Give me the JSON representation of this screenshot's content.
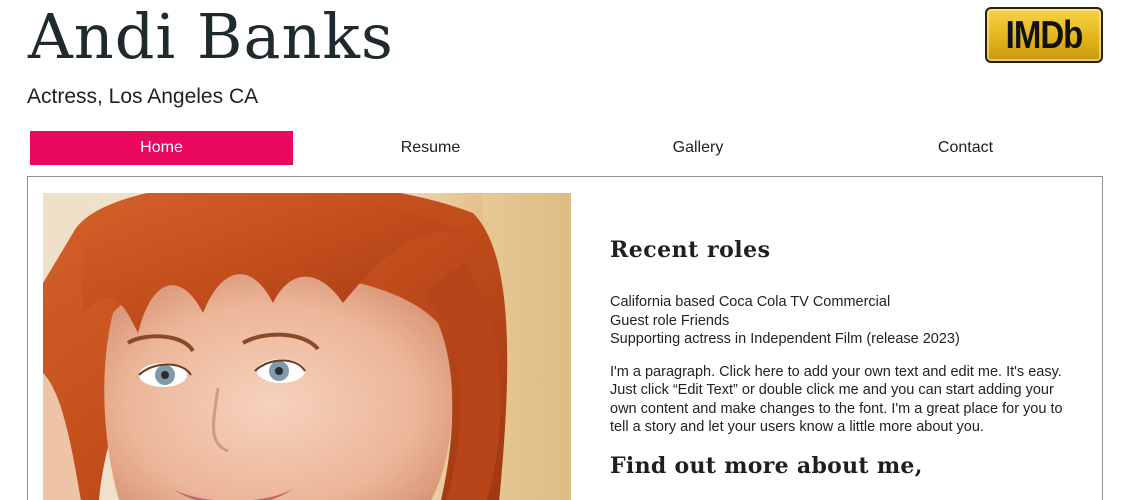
{
  "header": {
    "site_name": "Andi Banks",
    "tagline": "Actress, Los Angeles CA",
    "imdb_label": "IMDb"
  },
  "nav": {
    "items": [
      {
        "label": "Home",
        "active": true
      },
      {
        "label": "Resume",
        "active": false
      },
      {
        "label": "Gallery",
        "active": false
      },
      {
        "label": "Contact",
        "active": false
      }
    ]
  },
  "main": {
    "heading": "Recent roles",
    "roles": [
      "California based Coca Cola TV Commercial",
      "Guest role Friends",
      "Supporting actress in Independent Film (release 2023)"
    ],
    "paragraph": "I'm a paragraph. Click here to add your own text and edit me. It's easy. Just click “Edit Text” or double click me and you can start adding your own content and make changes to the font. I'm a great place for you to tell a story and let your users know a little more about you.",
    "subheading": "Find out more about me,"
  },
  "colors": {
    "nav_active_bg": "#e8095f",
    "imdb_yellow": "#f5c518",
    "border": "#8e8e8e",
    "hair": "#c8501c"
  },
  "icons": {
    "imdb": "imdb-logo",
    "photo": "actress-headshot-photo"
  }
}
